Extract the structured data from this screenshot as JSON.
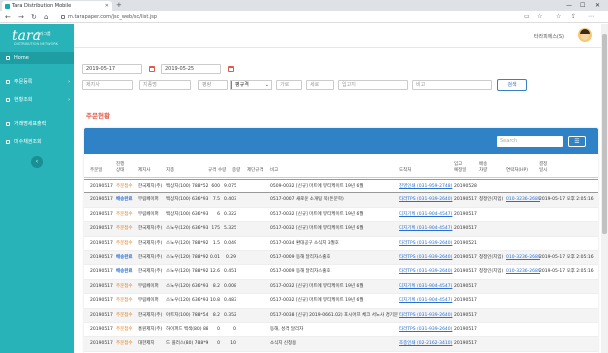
{
  "browser": {
    "tab_title": "Tara Distribution Mobile",
    "tab_close": "✕",
    "new_tab": "+",
    "url": "m.tarapaper.com/jsc_web/sc/list.jsp",
    "win_min": "—",
    "win_max": "☐",
    "win_close": "✕",
    "back": "←",
    "forward": "→",
    "reload": "↻",
    "home": "⌂"
  },
  "sidebar": {
    "logo": "tara",
    "logo_sub": "타라그룹",
    "logo_tag": "DISTRIBUTION NETWORK",
    "items": [
      {
        "label": "Home",
        "icon": "home-icon"
      },
      {
        "label": "주문등록",
        "icon": "order-icon"
      },
      {
        "label": "현황조회",
        "icon": "status-icon"
      },
      {
        "label": "거래명세표출력",
        "icon": "print-icon"
      },
      {
        "label": "미수채권조회",
        "icon": "receivable-icon"
      }
    ],
    "arrow": "›",
    "collapse": "‹"
  },
  "header": {
    "user_name": "타라피에스(S)"
  },
  "filters": {
    "date_from": "2019-05-17",
    "date_to": "2019-05-25",
    "product_ph": "제지사",
    "brand_ph": "지종명",
    "weight_ph": "평량",
    "grade_select": "평규격",
    "width_ph": "가로",
    "length_ph": "세로",
    "shipto_ph": "입고지",
    "memo_ph": "비고",
    "search_label": "검색"
  },
  "section_title": "주문현황",
  "table": {
    "search_placeholder": "Search",
    "list_icon": "☰",
    "headers": [
      "주문일",
      "진행\n상태",
      "제지사",
      "지종",
      "규격",
      "수량",
      "중량",
      "제단규격",
      "비고",
      "도착처",
      "입고\n예정일",
      "배송\n차량",
      "연락처(HP)",
      "결정\n일시"
    ],
    "rows": [
      {
        "date": "20190517",
        "status": "주문접수",
        "status_type": "orange",
        "maker": "한국제지(주)",
        "paper": "백상지(100) 788*526",
        "size": "",
        "qty": "600",
        "weight": "9.075",
        "cut": "",
        "note": "0509-0032 [신규] 마트에 뷰티케이트 19년 6월",
        "dest": "진영인쇄 (031-959-2748)",
        "eta": "20190528",
        "car": "",
        "phone": "",
        "decided": ""
      },
      {
        "date": "20190517",
        "status": "배송완료",
        "status_type": "blue",
        "maker": "무림페이퍼",
        "paper": "백상지(100) 636*939",
        "size": "",
        "qty": "7.5",
        "weight": "0.403",
        "cut": "",
        "note": "0517-0007 새로운 소개팅 북(돈문학)",
        "dest": "타라TPS (031-939-2640)",
        "eta": "20190517",
        "car": "청정인(지입)",
        "phone": "010-3236-2689",
        "decided": "2019-05-17 오후 2:05:16"
      },
      {
        "date": "20190517",
        "status": "주문접수",
        "status_type": "orange",
        "maker": "무림페이퍼",
        "paper": "백상지(100) 636*939",
        "size": "",
        "qty": "6",
        "weight": "0.322",
        "cut": "",
        "note": "0517-0032 [신규] 마트에 뷰티케이트 19년 6월",
        "dest": "디지기획 (031-904-4547)",
        "eta": "20190517",
        "car": "",
        "phone": "",
        "decided": ""
      },
      {
        "date": "20190517",
        "status": "주문접수",
        "status_type": "orange",
        "maker": "한국제지(주)",
        "paper": "스노우(120) 636*939",
        "size": "",
        "qty": "175",
        "weight": "5.325",
        "cut": "",
        "note": "0517-0032 [신규] 마트에 뷰티케이트 19년 6월",
        "dest": "디지기획 (031-904-4547)",
        "eta": "20190517",
        "car": "",
        "phone": "",
        "decided": ""
      },
      {
        "date": "20190517",
        "status": "주문접수",
        "status_type": "orange",
        "maker": "한국제지(주)",
        "paper": "스노우(120) 788*925",
        "size": "",
        "qty": "1.5",
        "weight": "0.049",
        "cut": "",
        "note": "0517-0034 환대공구 소식지 3월호",
        "dest": "타라TPS (031-939-2640)",
        "eta": "20190521",
        "car": "",
        "phone": "",
        "decided": ""
      },
      {
        "date": "20190517",
        "status": "배송완료",
        "status_type": "blue",
        "maker": "한국제지(주)",
        "paper": "스노우(120) 788*925",
        "size": "",
        "qty": "0.01",
        "weight": "0.29",
        "cut": "",
        "note": "0517-0009 동해 달리자스출호",
        "dest": "타라TPS (031-939-2640)",
        "eta": "20190517",
        "car": "청정인(지입)",
        "phone": "010-3236-2689",
        "decided": "2019-05-17 오후 2:05:16"
      },
      {
        "date": "20190517",
        "status": "배송완료",
        "status_type": "blue",
        "maker": "한국제지(주)",
        "paper": "스노우(120) 788*925",
        "size": "",
        "qty": "12.69",
        "weight": "0.451",
        "cut": "",
        "note": "0517-0009 동해 달리자스출호",
        "dest": "타라TPS (031-939-2640)",
        "eta": "20190517",
        "car": "청정인(지입)",
        "phone": "010-3236-2689",
        "decided": "2019-05-17 오후 2:05:16"
      },
      {
        "date": "20190517",
        "status": "주문접수",
        "status_type": "orange",
        "maker": "무림페이퍼",
        "paper": "스노우(120) 636*939",
        "size": "",
        "qty": "8.2",
        "weight": "0.008",
        "cut": "",
        "note": "0517-0032 [신규] 마트에 뷰티케이트 19년 6월",
        "dest": "디지기획 (031-904-4547)",
        "eta": "20190517",
        "car": "",
        "phone": "",
        "decided": ""
      },
      {
        "date": "20190517",
        "status": "주문접수",
        "status_type": "orange",
        "maker": "무림페이퍼",
        "paper": "스노우(120) 636*939",
        "size": "",
        "qty": "10.8",
        "weight": "0.483",
        "cut": "",
        "note": "0517-0032 [신규] 마트에 뷰티케이트 19년 6월",
        "dest": "디지기획 (031-904-4547)",
        "eta": "20190517",
        "car": "",
        "phone": "",
        "decided": ""
      },
      {
        "date": "20190517",
        "status": "주문접수",
        "status_type": "orange",
        "maker": "한국제지(주)",
        "paper": "아트지(100) 788*545",
        "size": "",
        "qty": "8.2",
        "weight": "0.352",
        "cut": "",
        "note": "0517-0038 [신규] 2019-0661.02) 포시어프 체크 서노사 경기문학잡 사회",
        "dest": "타라TPS (031-939-2640)",
        "eta": "20190517",
        "car": "",
        "phone": "",
        "decided": ""
      },
      {
        "date": "20190517",
        "status": "주문접수",
        "status_type": "orange",
        "maker": "홍원제지(주)",
        "paper": "하이퍼드 백색(80) 880*9",
        "size": "",
        "qty": "0",
        "weight": "0",
        "cut": "",
        "note": "동해, 성격 달리자",
        "dest": "타라TPS (031-939-2640)",
        "eta": "20190517",
        "car": "",
        "phone": "",
        "decided": ""
      },
      {
        "date": "20190517",
        "status": "주문접수",
        "status_type": "orange",
        "maker": "대한제지",
        "paper": "드 플러스(80) 788*9",
        "size": "",
        "qty": "0",
        "weight": "10",
        "cut": "",
        "note": "소식지 신청용",
        "dest": "조종인쇄 (02-2162-3410)",
        "eta": "20190517",
        "car": "",
        "phone": "",
        "decided": ""
      }
    ]
  }
}
